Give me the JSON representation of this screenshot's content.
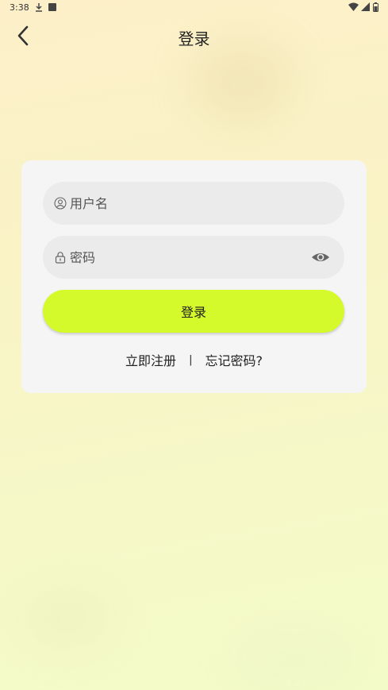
{
  "status_bar": {
    "time": "3:38"
  },
  "header": {
    "title": "登录"
  },
  "form": {
    "username_placeholder": "用户名",
    "password_placeholder": "密码",
    "login_label": "登录"
  },
  "links": {
    "register": "立即注册",
    "divider": "|",
    "forgot": "忘记密码?"
  },
  "colors": {
    "accent": "#d4fa2b",
    "card": "#f5f5f5",
    "field": "#ebebeb"
  }
}
